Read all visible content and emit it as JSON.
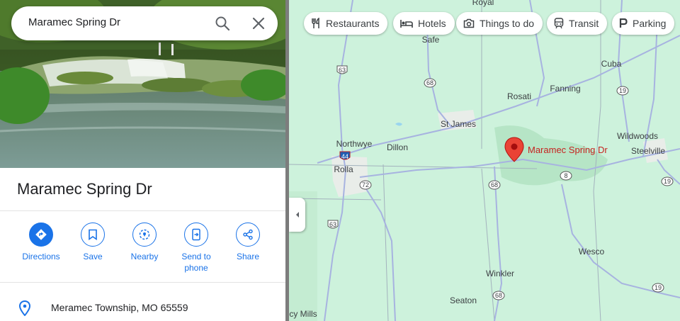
{
  "search": {
    "value": "Maramec Spring Dr"
  },
  "place": {
    "title": "Maramec Spring Dr",
    "address": "Meramec Township, MO 65559"
  },
  "actions": [
    {
      "label": "Directions"
    },
    {
      "label": "Save"
    },
    {
      "label": "Nearby"
    },
    {
      "label": "Send to\nphone"
    },
    {
      "label": "Share"
    }
  ],
  "chips": [
    {
      "label": "Restaurants",
      "icon": "restaurant-icon"
    },
    {
      "label": "Hotels",
      "icon": "hotel-icon"
    },
    {
      "label": "Things to do",
      "icon": "camera-icon"
    },
    {
      "label": "Transit",
      "icon": "transit-icon"
    },
    {
      "label": "Parking",
      "icon": "parking-icon"
    }
  ],
  "map": {
    "places": {
      "royal": "Royal",
      "safe": "Safe",
      "cuba": "Cuba",
      "rosati": "Rosati",
      "fanning": "Fanning",
      "st_james": "St James",
      "northwye": "Northwye",
      "dillon": "Dillon",
      "rolla": "Rolla",
      "wildwoods": "Wildwoods",
      "steelville": "Steelville",
      "wesco": "Wesco",
      "winkler": "Winkler",
      "seaton": "Seaton",
      "cy_mills": "cy Mills"
    },
    "marker_label": "Maramec Spring Dr",
    "shields": {
      "us63a": "63",
      "rt68a": "68",
      "i44": "44",
      "rt72": "72",
      "us63b": "63",
      "rt68b": "68",
      "rt8": "8",
      "rt19a": "19",
      "rt19b": "19",
      "rt68c": "68",
      "rt19c": "19"
    }
  },
  "colors": {
    "accent": "#1a73e8",
    "marker": "#ea4335",
    "marker_label": "#c5221f",
    "map_bg": "#cdf2dc"
  }
}
